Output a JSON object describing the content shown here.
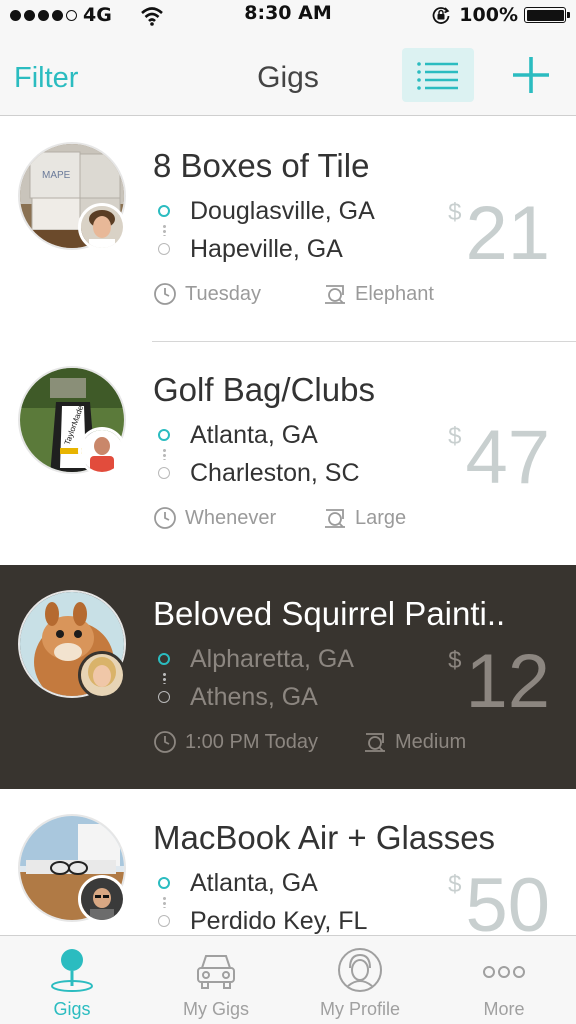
{
  "status_bar": {
    "carrier": "4G",
    "time": "8:30 AM",
    "battery": "100%"
  },
  "nav": {
    "filter_label": "Filter",
    "title": "Gigs"
  },
  "gigs": [
    {
      "title": "8 Boxes of Tile",
      "origin": "Douglasville, GA",
      "destination": "Hapeville, GA",
      "currency": "$",
      "price": "21",
      "time": "Tuesday",
      "size": "Elephant",
      "item_image": "tile-boxes-photo",
      "poster_image": "user-avatar-man-curly-hair"
    },
    {
      "title": "Golf Bag/Clubs",
      "origin": "Atlanta, GA",
      "destination": "Charleston, SC",
      "currency": "$",
      "price": "47",
      "time": "Whenever",
      "size": "Large",
      "item_image": "golf-bag-photo",
      "poster_image": "user-avatar-man-red-shirt"
    },
    {
      "title": "Beloved Squirrel Painti..",
      "origin": "Alpharetta, GA",
      "destination": "Athens, GA",
      "currency": "$",
      "price": "12",
      "time": "1:00 PM Today",
      "size": "Medium",
      "selected": true,
      "item_image": "squirrel-painting-photo",
      "poster_image": "user-avatar-woman-blonde"
    },
    {
      "title": "MacBook Air + Glasses",
      "origin": "Atlanta, GA",
      "destination": "Perdido Key, FL",
      "currency": "$",
      "price": "50",
      "time": "",
      "size": "",
      "item_image": "macbook-glasses-photo",
      "poster_image": "user-avatar-man-glasses"
    }
  ],
  "tabs": [
    {
      "label": "Gigs",
      "icon": "map-pin-icon",
      "active": true
    },
    {
      "label": "My Gigs",
      "icon": "car-icon",
      "active": false
    },
    {
      "label": "My Profile",
      "icon": "profile-face-icon",
      "active": false
    },
    {
      "label": "More",
      "icon": "more-dots-icon",
      "active": false
    }
  ],
  "colors": {
    "accent": "#2bbcc0",
    "selected_row": "#38342f",
    "bar_bg": "#f7f7f7"
  }
}
